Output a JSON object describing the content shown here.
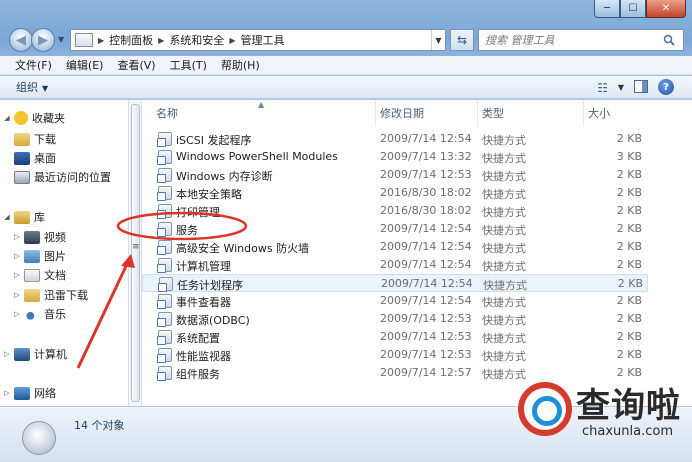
{
  "window": {
    "controls": [
      "─",
      "☐",
      "✕"
    ]
  },
  "address": {
    "crumbs": [
      "控制面板",
      "系统和安全",
      "管理工具"
    ],
    "search_placeholder": "搜索 管理工具"
  },
  "menu": [
    "文件(F)",
    "编辑(E)",
    "查看(V)",
    "工具(T)",
    "帮助(H)"
  ],
  "toolbar": {
    "organize_label": "组织"
  },
  "navpane": {
    "favorites": {
      "label": "收藏夹",
      "items": [
        "下载",
        "桌面",
        "最近访问的位置"
      ]
    },
    "libraries": {
      "label": "库",
      "items": [
        "视频",
        "图片",
        "文档",
        "迅雷下载",
        "音乐"
      ]
    },
    "computer": "计算机",
    "network": "网络"
  },
  "columns": {
    "name": "名称",
    "date": "修改日期",
    "type": "类型",
    "size": "大小"
  },
  "files": [
    {
      "name": "iSCSI 发起程序",
      "date": "2009/7/14 12:54",
      "type": "快捷方式",
      "size": "2 KB"
    },
    {
      "name": "Windows PowerShell Modules",
      "date": "2009/7/14 13:32",
      "type": "快捷方式",
      "size": "3 KB"
    },
    {
      "name": "Windows 内存诊断",
      "date": "2009/7/14 12:53",
      "type": "快捷方式",
      "size": "2 KB"
    },
    {
      "name": "本地安全策略",
      "date": "2016/8/30 18:02",
      "type": "快捷方式",
      "size": "2 KB"
    },
    {
      "name": "打印管理",
      "date": "2016/8/30 18:02",
      "type": "快捷方式",
      "size": "2 KB"
    },
    {
      "name": "服务",
      "date": "2009/7/14 12:54",
      "type": "快捷方式",
      "size": "2 KB"
    },
    {
      "name": "高级安全 Windows 防火墙",
      "date": "2009/7/14 12:54",
      "type": "快捷方式",
      "size": "2 KB"
    },
    {
      "name": "计算机管理",
      "date": "2009/7/14 12:54",
      "type": "快捷方式",
      "size": "2 KB"
    },
    {
      "name": "任务计划程序",
      "date": "2009/7/14 12:54",
      "type": "快捷方式",
      "size": "2 KB"
    },
    {
      "name": "事件查看器",
      "date": "2009/7/14 12:54",
      "type": "快捷方式",
      "size": "2 KB"
    },
    {
      "name": "数据源(ODBC)",
      "date": "2009/7/14 12:53",
      "type": "快捷方式",
      "size": "2 KB"
    },
    {
      "name": "系统配置",
      "date": "2009/7/14 12:53",
      "type": "快捷方式",
      "size": "2 KB"
    },
    {
      "name": "性能监视器",
      "date": "2009/7/14 12:53",
      "type": "快捷方式",
      "size": "2 KB"
    },
    {
      "name": "组件服务",
      "date": "2009/7/14 12:57",
      "type": "快捷方式",
      "size": "2 KB"
    }
  ],
  "highlighted_row": 8,
  "status": {
    "count_text": "14 个对象"
  },
  "watermark": {
    "title": "查询啦",
    "domain": "chaxunla.com"
  },
  "colors": {
    "annotation": "#d9352b",
    "brand_red": "#d43b2c",
    "brand_blue": "#1d8fd8"
  }
}
